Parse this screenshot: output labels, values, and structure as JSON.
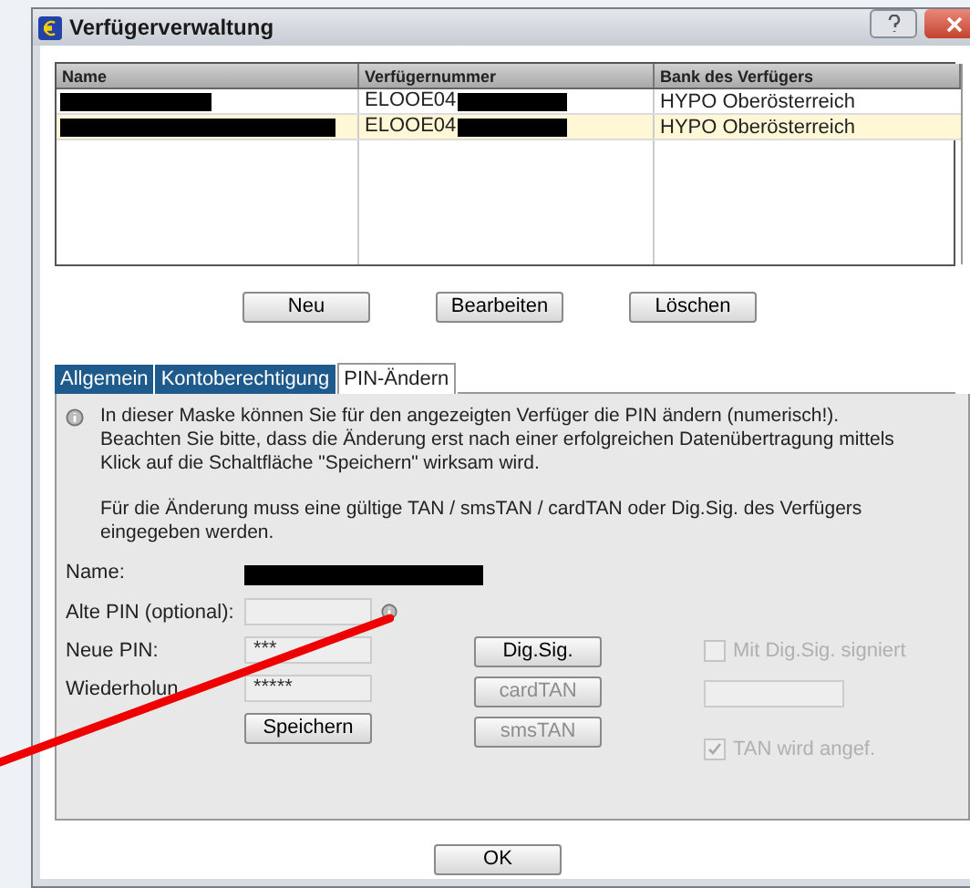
{
  "window": {
    "title": "Verfügerverwaltung"
  },
  "table": {
    "columns": [
      "Name",
      "Verfügernummer",
      "Bank des Verfügers"
    ],
    "rows": [
      {
        "number": "ELOOE04",
        "bank": "HYPO Oberösterreich",
        "selected": false
      },
      {
        "number": "ELOOE04",
        "bank": "HYPO Oberösterreich",
        "selected": true
      }
    ]
  },
  "list_buttons": [
    "Neu",
    "Bearbeiten",
    "Löschen"
  ],
  "tabs": [
    {
      "label": "Allgemein",
      "selected": false
    },
    {
      "label": "Kontoberechtigung",
      "selected": false
    },
    {
      "label": "PIN-Ändern",
      "selected": true
    }
  ],
  "info": [
    "In dieser Maske können Sie für den angezeigten Verfüger die PIN ändern (numerisch!). Beachten Sie bitte, dass die Änderung erst nach einer erfolgreichen Datenübertragung mittels Klick auf die Schaltfläche \"Speichern\" wirksam wird.",
    "Für die Änderung muss eine gültige TAN / smsTAN / cardTAN oder Dig.Sig. des Verfügers eingegeben werden."
  ],
  "form": {
    "name_label": "Name:",
    "old_pin_label": "Alte PIN (optional):",
    "new_pin_label": "Neue PIN:",
    "new_pin_value": "***",
    "repeat_label": "Wiederholun",
    "repeat_value": "*****",
    "save": "Speichern"
  },
  "auth_buttons": [
    {
      "label": "Dig.Sig.",
      "disabled": false
    },
    {
      "label": "cardTAN",
      "disabled": true
    },
    {
      "label": "smsTAN",
      "disabled": true
    }
  ],
  "sign_checkbox": {
    "label": "Mit Dig.Sig. signiert",
    "checked": false,
    "disabled": true
  },
  "tan_checkbox": {
    "label": "TAN wird angef.",
    "checked": true,
    "disabled": true
  },
  "ok": "OK"
}
